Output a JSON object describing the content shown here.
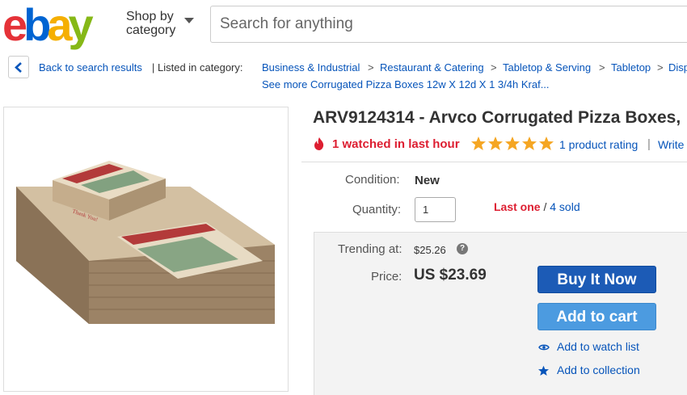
{
  "header": {
    "logo": {
      "e": "e",
      "b": "b",
      "a": "a",
      "y": "y"
    },
    "shop_by_line1": "Shop by",
    "shop_by_line2": "category",
    "search_placeholder": "Search for anything"
  },
  "breadcrumb": {
    "back_label": "Back to search results",
    "listed_label": "|  Listed in category:",
    "items": [
      "Business & Industrial",
      "Restaurant & Catering",
      "Tabletop & Serving",
      "Tabletop",
      "Disp"
    ],
    "separator": ">",
    "see_more": "See more Corrugated Pizza Boxes 12w X 12d X 1 3/4h Kraf..."
  },
  "product": {
    "title": "ARV9124314 - Arvco Corrugated Pizza Boxes,",
    "watched": "1 watched in last hour",
    "rating_stars": 5,
    "rating_link": "1 product rating",
    "pipe": "|",
    "write_link": "Write",
    "condition_label": "Condition:",
    "condition_value": "New",
    "quantity_label": "Quantity:",
    "quantity_value": "1",
    "last_one": "Last one",
    "slash": "/",
    "sold": "4 sold",
    "trending_label": "Trending at:",
    "trending_value": "$25.26",
    "help": "?",
    "price_label": "Price:",
    "price_value": "US $23.69",
    "buy_now": "Buy It Now",
    "add_to_cart": "Add to cart",
    "watch_list": "Add to watch list",
    "collection": "Add to collection",
    "box_print": "Thank You!"
  },
  "colors": {
    "link": "#0654ba",
    "alert_red": "#dd1e31",
    "buy_button": "#1c5bb6",
    "cart_button": "#4c9be0",
    "star": "#f5a623"
  }
}
